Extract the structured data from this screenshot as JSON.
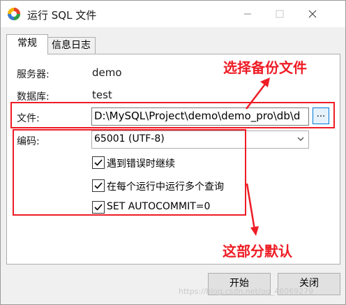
{
  "window": {
    "title": "运行 SQL 文件"
  },
  "tabs": [
    {
      "label": "常规",
      "active": true
    },
    {
      "label": "信息日志",
      "active": false
    }
  ],
  "form": {
    "server_label": "服务器:",
    "server_value": "demo",
    "database_label": "数据库:",
    "database_value": "test",
    "file_label": "文件:",
    "file_value": "D:\\MySQL\\Project\\demo\\demo_pro\\db\\d",
    "browse_label": "...",
    "encoding_label": "编码:",
    "encoding_value": "65001 (UTF-8)"
  },
  "options": [
    {
      "label": "遇到错误时继续",
      "checked": true
    },
    {
      "label": "在每个运行中运行多个查询",
      "checked": true
    },
    {
      "label": "SET AUTOCOMMIT=0",
      "checked": true
    }
  ],
  "annotations": {
    "select_file": "选择备份文件",
    "defaults": "这部分默认"
  },
  "buttons": {
    "start": "开始",
    "close": "关闭"
  },
  "watermark": "https://blog.csdn.net/qq_46069279",
  "colors": {
    "annotation_red": "#ee1c25",
    "button_focus": "#0078d7"
  }
}
